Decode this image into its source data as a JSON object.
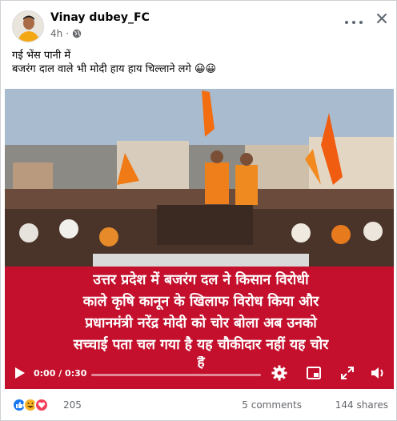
{
  "post": {
    "author": "Vinay dubey_FC",
    "time": "4h",
    "privacy_icon": "globe-icon",
    "text_lines": [
      "गई भेंस पानी में",
      "बजरंग दाल वाले भी मोदी हाय हाय चिल्लाने लगे 😀😀"
    ]
  },
  "video": {
    "caption_lines": [
      "उत्तर प्रदेश में बजरंग दल ने किसान विरोधी",
      "काले कृषि कानून के खिलाफ विरोध किया और",
      "प्रधानमंत्री नरेंद्र मोदी को चोर बोला अब उनको",
      "सच्चाई पता चल गया है यह चौकीदार नहीं यह चोर",
      "है"
    ],
    "time": "0:00 / 0:30",
    "progress": 0,
    "icons": [
      "play-icon",
      "settings-icon",
      "picture-in-picture-icon",
      "fullscreen-icon",
      "volume-icon"
    ]
  },
  "footer": {
    "reaction_count": "205",
    "comments": "5 comments",
    "shares": "144 shares"
  },
  "colors": {
    "caption_bg": "#c4102c",
    "like_blue": "#1877f2",
    "haha_yellow": "#f7b125",
    "love_red": "#f33e58"
  }
}
